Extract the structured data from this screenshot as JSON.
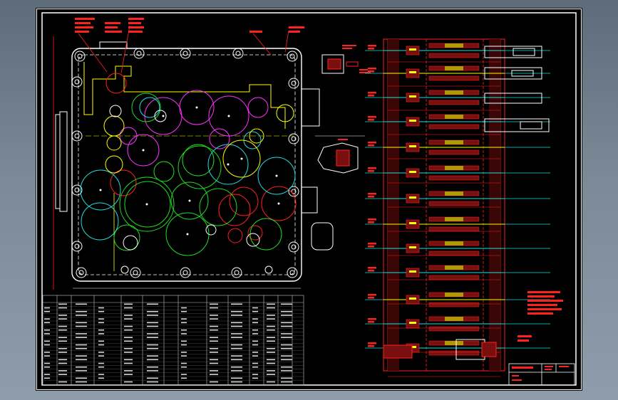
{
  "colors": {
    "frame": "#ffffff",
    "outline": "#ffffff",
    "centerline": "#ffff00",
    "annotation": "#ff2020",
    "magenta": "#ff33ff",
    "green": "#22dd22",
    "cyan": "#22dddd",
    "yellow": "#ffff00",
    "shaft_fill": "#7a0f0f",
    "grid": "#c8c8c8"
  },
  "icons": {
    "gear": "gear-circle-icon",
    "bolt": "bolt-hole-icon"
  }
}
